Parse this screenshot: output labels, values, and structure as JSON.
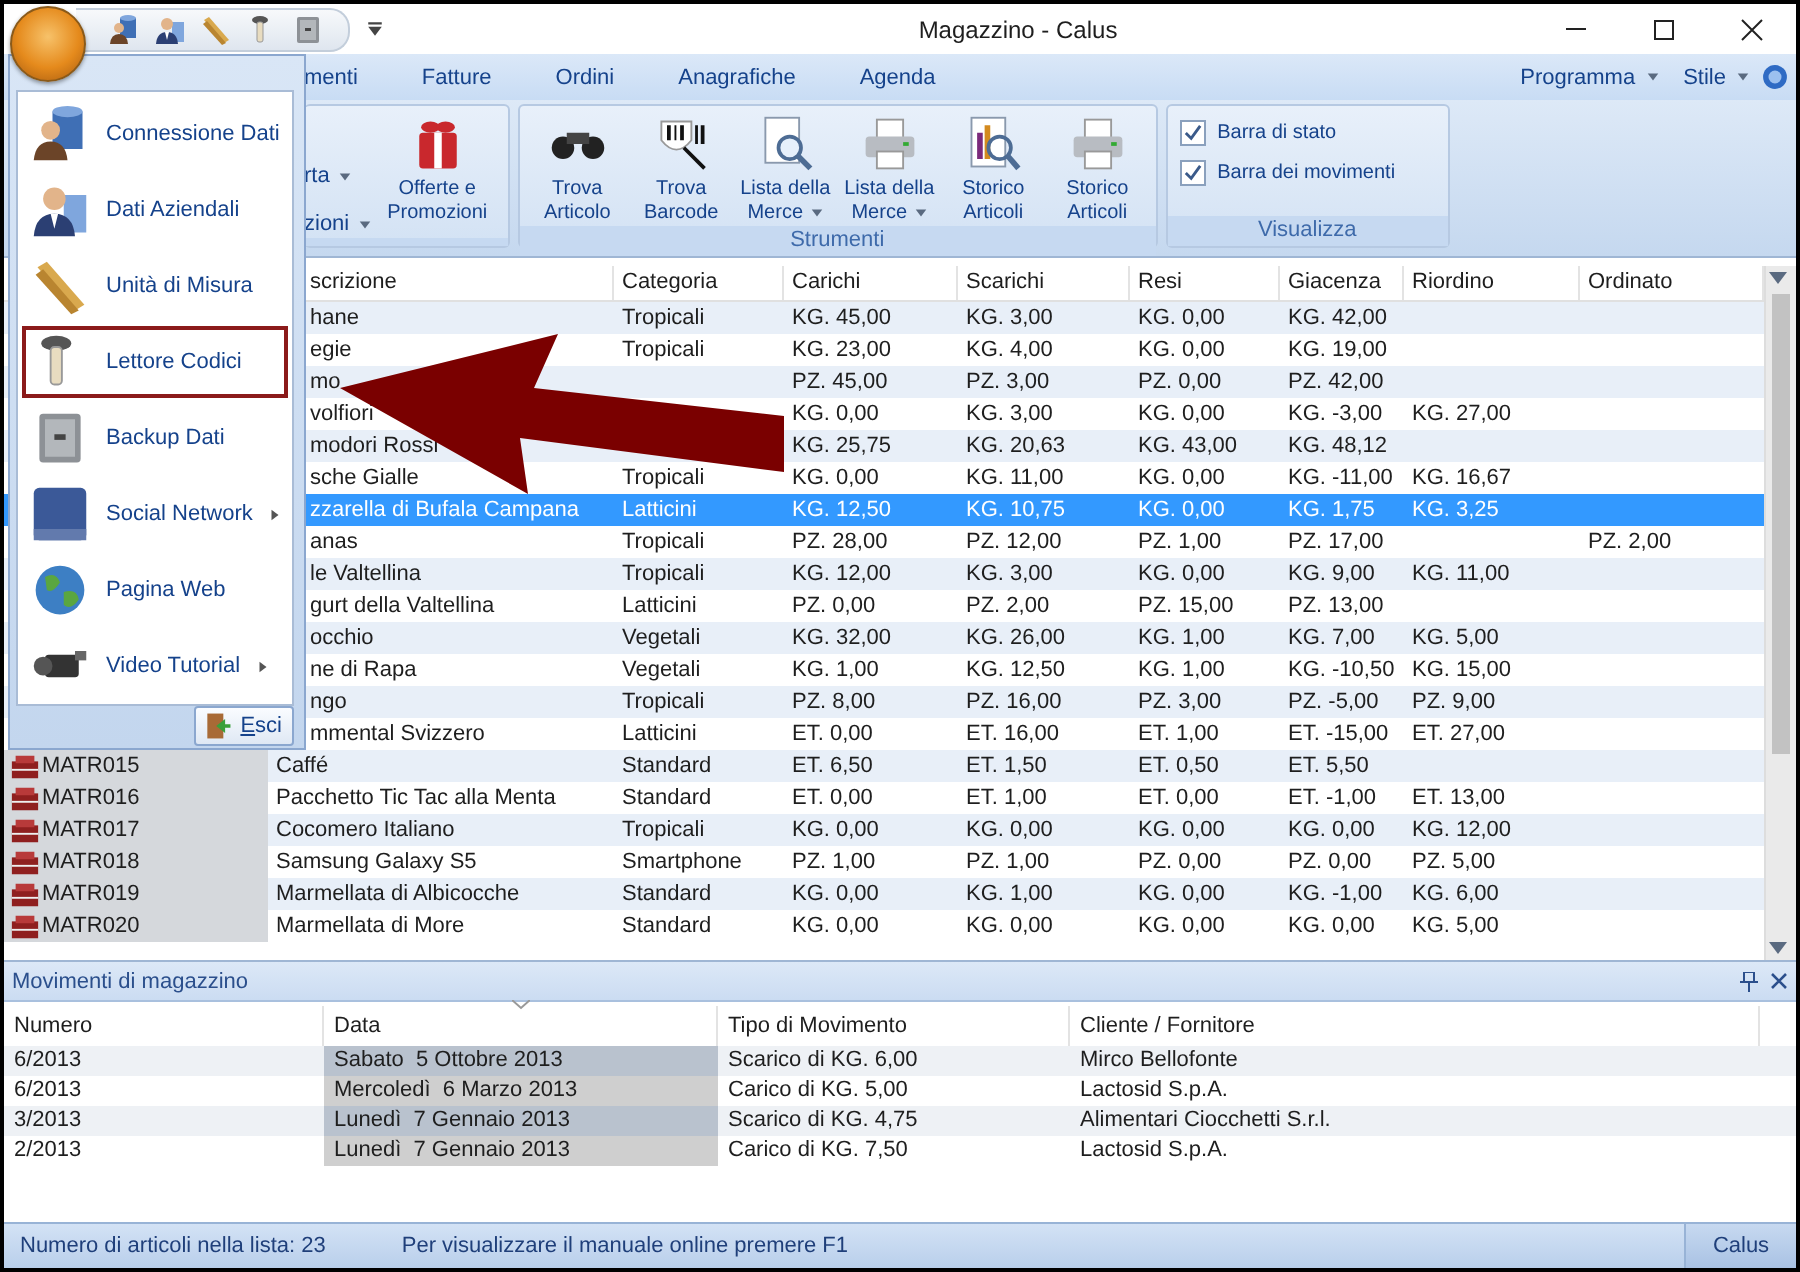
{
  "window": {
    "title": "Magazzino - Calus"
  },
  "ribbon_tabs": [
    "menti",
    "Fatture",
    "Ordini",
    "Anagrafiche",
    "Agenda"
  ],
  "ribbon_menus": [
    "Programma",
    "Stile"
  ],
  "ribbon": {
    "groups": [
      {
        "small_buttons": [
          {
            "label": "rta",
            "dropdown": true
          },
          {
            "label": "zioni",
            "dropdown": true
          }
        ],
        "buttons": [
          {
            "label": "Offerte e Promozioni",
            "dropdown": false
          }
        ]
      },
      {
        "label": "Strumenti",
        "buttons": [
          {
            "label": "Trova Articolo",
            "dropdown": false
          },
          {
            "label": "Trova Barcode",
            "dropdown": false
          },
          {
            "label": "Lista della Merce",
            "dropdown": true
          },
          {
            "label": "Lista della Merce",
            "dropdown": true
          },
          {
            "label": "Storico Articoli",
            "dropdown": false
          },
          {
            "label": "Storico Articoli",
            "dropdown": false
          }
        ]
      },
      {
        "label": "Visualizza",
        "checkboxes": [
          {
            "label": "Barra di stato",
            "checked": true
          },
          {
            "label": "Barra dei movimenti",
            "checked": true
          }
        ]
      }
    ]
  },
  "app_menu": {
    "items": [
      {
        "label": "Connessione Dati",
        "selected": false,
        "submenu": false
      },
      {
        "label": "Dati Aziendali",
        "selected": false,
        "submenu": false
      },
      {
        "label": "Unità di Misura",
        "selected": false,
        "submenu": false
      },
      {
        "label": "Lettore Codici",
        "selected": true,
        "submenu": false
      },
      {
        "label": "Backup Dati",
        "selected": false,
        "submenu": false
      },
      {
        "label": "Social Network",
        "selected": false,
        "submenu": true
      },
      {
        "label": "Pagina Web",
        "selected": false,
        "submenu": false
      },
      {
        "label": "Video Tutorial",
        "selected": false,
        "submenu": true
      }
    ],
    "exit_button": "Esci"
  },
  "table": {
    "columns": [
      "scrizione",
      "Categoria",
      "Carichi",
      "Scarichi",
      "Resi",
      "Giacenza",
      "Riordino",
      "Ordinato"
    ],
    "rows": [
      {
        "selected": false,
        "cells": [
          "hane",
          "Tropicali",
          "KG. 45,00",
          "KG. 3,00",
          "KG. 0,00",
          "KG. 42,00",
          null,
          null
        ]
      },
      {
        "selected": false,
        "cells": [
          "egie",
          "Tropicali",
          "KG. 23,00",
          "KG. 4,00",
          "KG. 0,00",
          "KG. 19,00",
          null,
          null
        ]
      },
      {
        "selected": false,
        "cells": [
          "mo",
          null,
          "PZ. 45,00",
          "PZ. 3,00",
          "PZ. 0,00",
          "PZ. 42,00",
          null,
          null
        ]
      },
      {
        "selected": false,
        "cells": [
          "volfiori",
          null,
          "KG. 0,00",
          "KG. 3,00",
          "KG. 0,00",
          "KG. -3,00",
          "KG. 27,00",
          null
        ]
      },
      {
        "selected": false,
        "cells": [
          "modori Rossi",
          null,
          "KG. 25,75",
          "KG. 20,63",
          "KG. 43,00",
          "KG. 48,12",
          null,
          null
        ]
      },
      {
        "selected": false,
        "cells": [
          "sche Gialle",
          "Tropicali",
          "KG. 0,00",
          "KG. 11,00",
          "KG. 0,00",
          "KG. -11,00",
          "KG. 16,67",
          null
        ]
      },
      {
        "selected": true,
        "cells": [
          "zzarella di Bufala Campana",
          "Latticini",
          "KG. 12,50",
          "KG. 10,75",
          "KG. 0,00",
          "KG. 1,75",
          "KG. 3,25",
          null
        ]
      },
      {
        "selected": false,
        "cells": [
          "anas",
          "Tropicali",
          "PZ. 28,00",
          "PZ. 12,00",
          "PZ. 1,00",
          "PZ. 17,00",
          null,
          "PZ. 2,00"
        ]
      },
      {
        "selected": false,
        "cells": [
          "le Valtellina",
          "Tropicali",
          "KG. 12,00",
          "KG. 3,00",
          "KG. 0,00",
          "KG. 9,00",
          "KG. 11,00",
          null
        ]
      },
      {
        "selected": false,
        "cells": [
          "gurt della Valtellina",
          "Latticini",
          "PZ. 0,00",
          "PZ. 2,00",
          "PZ. 15,00",
          "PZ. 13,00",
          null,
          null
        ]
      },
      {
        "selected": false,
        "cells": [
          "occhio",
          "Vegetali",
          "KG. 32,00",
          "KG. 26,00",
          "KG. 1,00",
          "KG. 7,00",
          "KG. 5,00",
          null
        ]
      },
      {
        "selected": false,
        "cells": [
          "ne di Rapa",
          "Vegetali",
          "KG. 1,00",
          "KG. 12,50",
          "KG. 1,00",
          "KG. -10,50",
          "KG. 15,00",
          null
        ]
      },
      {
        "selected": false,
        "cells": [
          "ngo",
          "Tropicali",
          "PZ. 8,00",
          "PZ. 16,00",
          "PZ. 3,00",
          "PZ. -5,00",
          "PZ. 9,00",
          null
        ]
      },
      {
        "selected": false,
        "cells": [
          "mmental Svizzero",
          "Latticini",
          "ET. 0,00",
          "ET. 16,00",
          "ET. 1,00",
          "ET. -15,00",
          "ET. 27,00",
          null
        ]
      },
      {
        "code": "MATR015",
        "selected": false,
        "cells": [
          "Caffé",
          "Standard",
          "ET. 6,50",
          "ET. 1,50",
          "ET. 0,50",
          "ET. 5,50",
          null,
          null
        ]
      },
      {
        "code": "MATR016",
        "selected": false,
        "cells": [
          "Pacchetto Tic Tac alla Menta",
          "Standard",
          "ET. 0,00",
          "ET. 1,00",
          "ET. 0,00",
          "ET. -1,00",
          "ET. 13,00",
          null
        ]
      },
      {
        "code": "MATR017",
        "selected": false,
        "cells": [
          "Cocomero Italiano",
          "Tropicali",
          "KG. 0,00",
          "KG. 0,00",
          "KG. 0,00",
          "KG. 0,00",
          "KG. 12,00",
          null
        ]
      },
      {
        "code": "MATR018",
        "selected": false,
        "cells": [
          "Samsung Galaxy S5",
          "Smartphone",
          "PZ. 1,00",
          "PZ. 1,00",
          "PZ. 0,00",
          "PZ. 0,00",
          "PZ. 5,00",
          null
        ]
      },
      {
        "code": "MATR019",
        "selected": false,
        "cells": [
          "Marmellata di Albicocche",
          "Standard",
          "KG. 0,00",
          "KG. 1,00",
          "KG. 0,00",
          "KG. -1,00",
          "KG. 6,00",
          null
        ]
      },
      {
        "code": "MATR020",
        "selected": false,
        "cells": [
          "Marmellata di More",
          "Standard",
          "KG. 0,00",
          "KG. 0,00",
          "KG. 0,00",
          "KG. 0,00",
          "KG. 5,00",
          null
        ]
      }
    ]
  },
  "movements": {
    "title": "Movimenti di magazzino",
    "columns": [
      {
        "label": "Numero",
        "sorted": false
      },
      {
        "label": "Data",
        "sorted": true
      },
      {
        "label": "Tipo di Movimento",
        "sorted": false
      },
      {
        "label": "Cliente / Fornitore",
        "sorted": false
      }
    ],
    "rows": [
      [
        "6/2013",
        "Sabato  5 Ottobre 2013",
        "Scarico di KG. 6,00",
        "Mirco Bellofonte"
      ],
      [
        "6/2013",
        "Mercoledì  6 Marzo 2013",
        "Carico di KG. 5,00",
        "Lactosid S.p.A."
      ],
      [
        "3/2013",
        "Lunedì  7 Gennaio 2013",
        "Scarico di KG. 4,75",
        "Alimentari Ciocchetti S.r.l."
      ],
      [
        "2/2013",
        "Lunedì  7 Gennaio 2013",
        "Carico di KG. 7,50",
        "Lactosid S.p.A."
      ]
    ]
  },
  "status_bar": {
    "count": "Numero di articoli nella lista: 23",
    "hint": "Per visualizzare il manuale online premere F1",
    "user": "Calus"
  }
}
